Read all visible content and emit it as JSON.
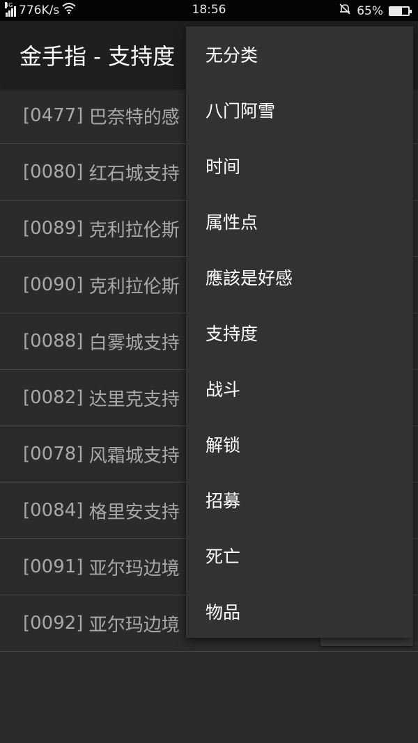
{
  "status_bar": {
    "network_type": "4G",
    "speed": "776K/s",
    "time": "18:56",
    "battery_percent": "65%",
    "battery_level": 0.65,
    "icons": [
      "signal-icon",
      "wifi-icon",
      "bell-muted-icon",
      "battery-icon"
    ]
  },
  "app_bar": {
    "title": "金手指 - 支持度"
  },
  "list": {
    "items": [
      {
        "code": "[0477]",
        "text": "巴奈特的感"
      },
      {
        "code": "[0080]",
        "text": "红石城支持"
      },
      {
        "code": "[0089]",
        "text": "克利拉伦斯"
      },
      {
        "code": "[0090]",
        "text": "克利拉伦斯"
      },
      {
        "code": "[0088]",
        "text": "白雾城支持"
      },
      {
        "code": "[0082]",
        "text": "达里克支持"
      },
      {
        "code": "[0078]",
        "text": "风霜城支持"
      },
      {
        "code": "[0084]",
        "text": "格里安支持"
      },
      {
        "code": "[0091]",
        "text": "亚尔玛边境"
      },
      {
        "code": "[0092]",
        "text": "亚尔玛边境"
      }
    ]
  },
  "menu": {
    "items": [
      "无分类",
      "八门阿雪",
      "时间",
      "属性点",
      "應該是好感",
      "支持度",
      "战斗",
      "解锁",
      "招募",
      "死亡",
      "物品"
    ]
  },
  "colors": {
    "background": "#2b2b2b",
    "app_bar": "#1e1e1e",
    "menu_background": "#323232",
    "list_text": "#a9a9a9",
    "menu_text": "#ffffff"
  }
}
